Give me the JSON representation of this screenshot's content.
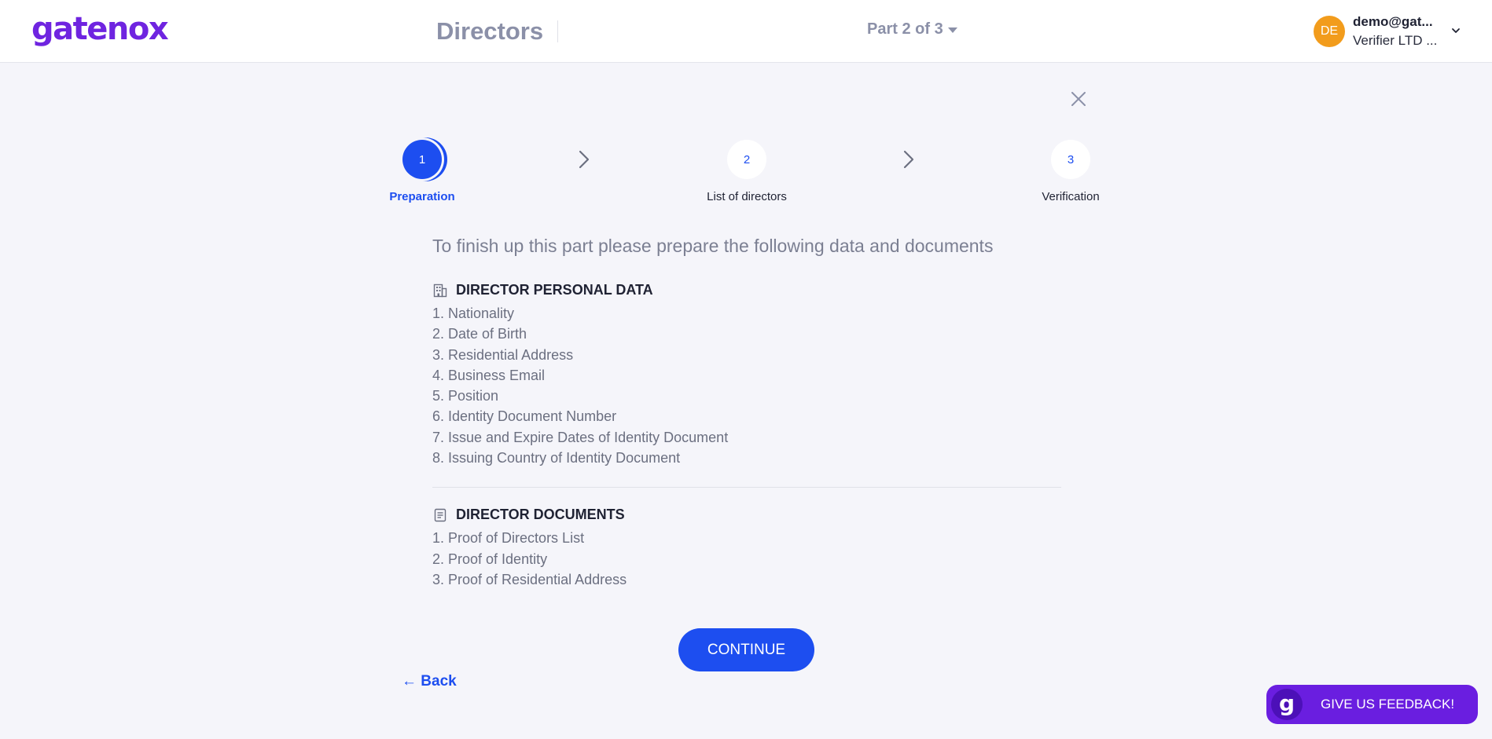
{
  "header": {
    "logo": "gatenox",
    "page_title": "Directors",
    "part_selector": "Part 2 of 3",
    "user": {
      "initials": "DE",
      "email": "demo@gat...",
      "org": "Verifier LTD ..."
    }
  },
  "stepper": {
    "steps": [
      {
        "number": "1",
        "label": "Preparation",
        "state": "active"
      },
      {
        "number": "2",
        "label": "List of directors",
        "state": "todo"
      },
      {
        "number": "3",
        "label": "Verification",
        "state": "todo"
      }
    ]
  },
  "content": {
    "intro": "To finish up this part please prepare the following data and documents",
    "personal_data": {
      "title": "DIRECTOR PERSONAL DATA",
      "icon": "building-icon",
      "items": [
        "1. Nationality",
        "2. Date of Birth",
        "3. Residential Address",
        "4. Business Email",
        "5. Position",
        "6. Identity Document Number",
        "7. Issue and Expire Dates of Identity Document",
        "8. Issuing Country of Identity Document"
      ]
    },
    "documents": {
      "title": "DIRECTOR DOCUMENTS",
      "icon": "document-icon",
      "items": [
        "1. Proof of Directors List",
        "2. Proof of Identity",
        "3. Proof of Residential Address"
      ]
    }
  },
  "actions": {
    "continue_label": "CONTINUE",
    "back_label": "← Back"
  },
  "feedback": {
    "badge": "g",
    "label": "GIVE US FEEDBACK!"
  },
  "colors": {
    "primary": "#1d4ef0",
    "brand": "#6f24e0",
    "avatar": "#f29c1c",
    "background": "#f5f5fa"
  }
}
